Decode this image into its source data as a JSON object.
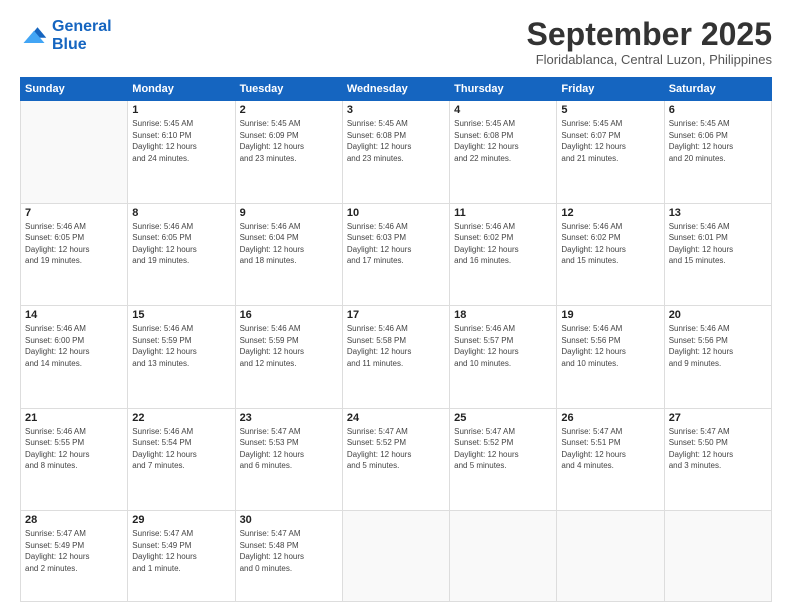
{
  "logo": {
    "line1": "General",
    "line2": "Blue"
  },
  "header": {
    "month": "September 2025",
    "location": "Floridablanca, Central Luzon, Philippines"
  },
  "weekdays": [
    "Sunday",
    "Monday",
    "Tuesday",
    "Wednesday",
    "Thursday",
    "Friday",
    "Saturday"
  ],
  "weeks": [
    [
      {
        "day": "",
        "info": ""
      },
      {
        "day": "1",
        "info": "Sunrise: 5:45 AM\nSunset: 6:10 PM\nDaylight: 12 hours\nand 24 minutes."
      },
      {
        "day": "2",
        "info": "Sunrise: 5:45 AM\nSunset: 6:09 PM\nDaylight: 12 hours\nand 23 minutes."
      },
      {
        "day": "3",
        "info": "Sunrise: 5:45 AM\nSunset: 6:08 PM\nDaylight: 12 hours\nand 23 minutes."
      },
      {
        "day": "4",
        "info": "Sunrise: 5:45 AM\nSunset: 6:08 PM\nDaylight: 12 hours\nand 22 minutes."
      },
      {
        "day": "5",
        "info": "Sunrise: 5:45 AM\nSunset: 6:07 PM\nDaylight: 12 hours\nand 21 minutes."
      },
      {
        "day": "6",
        "info": "Sunrise: 5:45 AM\nSunset: 6:06 PM\nDaylight: 12 hours\nand 20 minutes."
      }
    ],
    [
      {
        "day": "7",
        "info": "Sunrise: 5:46 AM\nSunset: 6:05 PM\nDaylight: 12 hours\nand 19 minutes."
      },
      {
        "day": "8",
        "info": "Sunrise: 5:46 AM\nSunset: 6:05 PM\nDaylight: 12 hours\nand 19 minutes."
      },
      {
        "day": "9",
        "info": "Sunrise: 5:46 AM\nSunset: 6:04 PM\nDaylight: 12 hours\nand 18 minutes."
      },
      {
        "day": "10",
        "info": "Sunrise: 5:46 AM\nSunset: 6:03 PM\nDaylight: 12 hours\nand 17 minutes."
      },
      {
        "day": "11",
        "info": "Sunrise: 5:46 AM\nSunset: 6:02 PM\nDaylight: 12 hours\nand 16 minutes."
      },
      {
        "day": "12",
        "info": "Sunrise: 5:46 AM\nSunset: 6:02 PM\nDaylight: 12 hours\nand 15 minutes."
      },
      {
        "day": "13",
        "info": "Sunrise: 5:46 AM\nSunset: 6:01 PM\nDaylight: 12 hours\nand 15 minutes."
      }
    ],
    [
      {
        "day": "14",
        "info": "Sunrise: 5:46 AM\nSunset: 6:00 PM\nDaylight: 12 hours\nand 14 minutes."
      },
      {
        "day": "15",
        "info": "Sunrise: 5:46 AM\nSunset: 5:59 PM\nDaylight: 12 hours\nand 13 minutes."
      },
      {
        "day": "16",
        "info": "Sunrise: 5:46 AM\nSunset: 5:59 PM\nDaylight: 12 hours\nand 12 minutes."
      },
      {
        "day": "17",
        "info": "Sunrise: 5:46 AM\nSunset: 5:58 PM\nDaylight: 12 hours\nand 11 minutes."
      },
      {
        "day": "18",
        "info": "Sunrise: 5:46 AM\nSunset: 5:57 PM\nDaylight: 12 hours\nand 10 minutes."
      },
      {
        "day": "19",
        "info": "Sunrise: 5:46 AM\nSunset: 5:56 PM\nDaylight: 12 hours\nand 10 minutes."
      },
      {
        "day": "20",
        "info": "Sunrise: 5:46 AM\nSunset: 5:56 PM\nDaylight: 12 hours\nand 9 minutes."
      }
    ],
    [
      {
        "day": "21",
        "info": "Sunrise: 5:46 AM\nSunset: 5:55 PM\nDaylight: 12 hours\nand 8 minutes."
      },
      {
        "day": "22",
        "info": "Sunrise: 5:46 AM\nSunset: 5:54 PM\nDaylight: 12 hours\nand 7 minutes."
      },
      {
        "day": "23",
        "info": "Sunrise: 5:47 AM\nSunset: 5:53 PM\nDaylight: 12 hours\nand 6 minutes."
      },
      {
        "day": "24",
        "info": "Sunrise: 5:47 AM\nSunset: 5:52 PM\nDaylight: 12 hours\nand 5 minutes."
      },
      {
        "day": "25",
        "info": "Sunrise: 5:47 AM\nSunset: 5:52 PM\nDaylight: 12 hours\nand 5 minutes."
      },
      {
        "day": "26",
        "info": "Sunrise: 5:47 AM\nSunset: 5:51 PM\nDaylight: 12 hours\nand 4 minutes."
      },
      {
        "day": "27",
        "info": "Sunrise: 5:47 AM\nSunset: 5:50 PM\nDaylight: 12 hours\nand 3 minutes."
      }
    ],
    [
      {
        "day": "28",
        "info": "Sunrise: 5:47 AM\nSunset: 5:49 PM\nDaylight: 12 hours\nand 2 minutes."
      },
      {
        "day": "29",
        "info": "Sunrise: 5:47 AM\nSunset: 5:49 PM\nDaylight: 12 hours\nand 1 minute."
      },
      {
        "day": "30",
        "info": "Sunrise: 5:47 AM\nSunset: 5:48 PM\nDaylight: 12 hours\nand 0 minutes."
      },
      {
        "day": "",
        "info": ""
      },
      {
        "day": "",
        "info": ""
      },
      {
        "day": "",
        "info": ""
      },
      {
        "day": "",
        "info": ""
      }
    ]
  ]
}
